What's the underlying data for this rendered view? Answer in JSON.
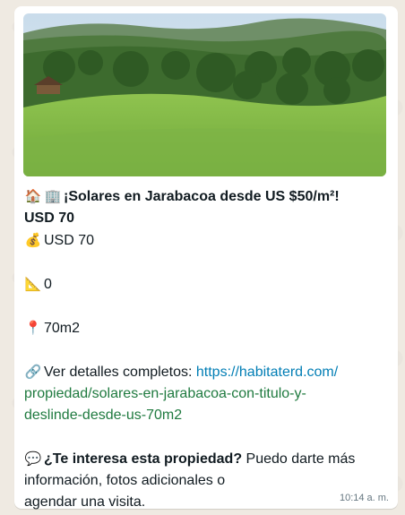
{
  "message": {
    "title_emojis": [
      "🏠",
      "🏢"
    ],
    "title": "¡Solares en Jarabacoa desde US $50/m²!",
    "price_heading": "USD 70",
    "price_emoji": "💰",
    "price": "USD 70",
    "area_emoji": "📐",
    "area": "0",
    "location_emoji": "📍",
    "location": "70m2",
    "link_emoji": "🔗",
    "link_label": "Ver detalles completos:",
    "link_line1": "https://habitaterd.com/",
    "link_line2": "propiedad/solares-en-jarabacoa-con-titulo-y-",
    "link_line3": "deslinde-desde-us-70m2",
    "cta_emoji": "💬",
    "cta_bold": "¿Te interesa esta propiedad?",
    "cta_rest1": " Puedo darte más",
    "cta_line2": "información, fotos adicionales o",
    "cta_line3": "agendar una visita.",
    "time": "10:14 a. m."
  },
  "icons": {
    "house": "house-icon",
    "building": "building-icon",
    "money": "money-bag-icon",
    "ruler": "ruler-icon",
    "pin": "pin-icon",
    "link": "link-icon",
    "speech": "speech-bubble-icon"
  },
  "colors": {
    "link": "#027eb5",
    "bubble": "#ffffff",
    "background": "#efeae2"
  }
}
